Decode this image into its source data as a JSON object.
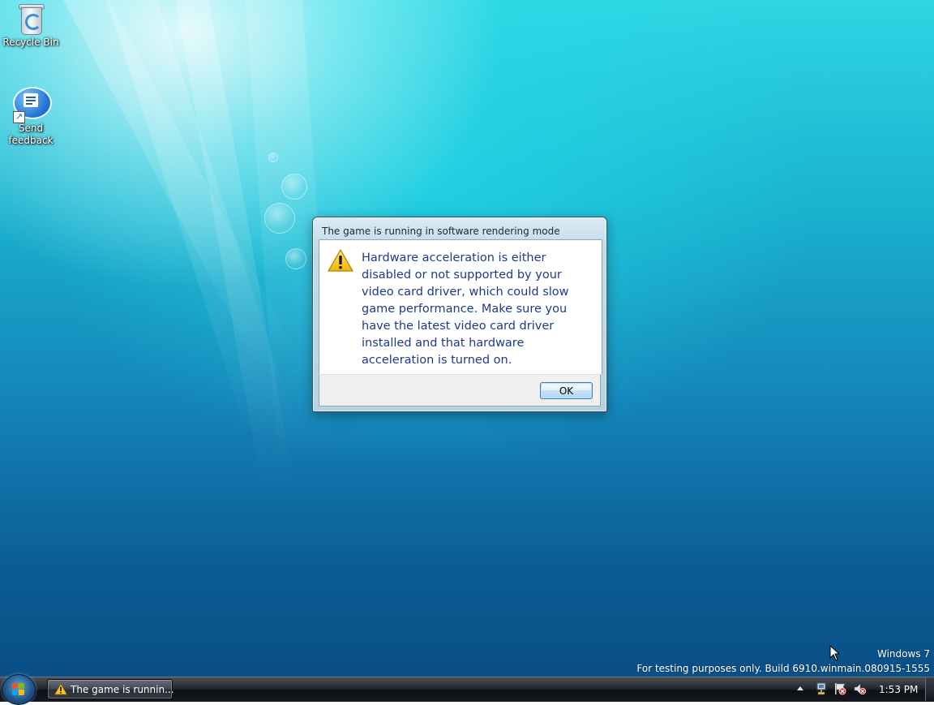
{
  "desktop": {
    "icons": [
      {
        "label": "Recycle Bin",
        "icon": "recycle-bin-icon"
      },
      {
        "label_line1": "Send",
        "label_line2": "feedback",
        "icon": "send-feedback-icon"
      }
    ],
    "watermark": {
      "line1": "Windows 7",
      "line2": "For testing purposes only. Build 6910.winmain.080915-1555"
    }
  },
  "dialog": {
    "title": "The game is running in software rendering mode",
    "icon": "warning-icon",
    "message": "Hardware acceleration is either disabled or not supported by your video card driver, which could slow game performance. Make sure you have the latest video card driver installed and that hardware acceleration is turned on.",
    "ok_label": "OK"
  },
  "taskbar": {
    "start_icon": "windows-start-orb",
    "task_label": "The game is runnin...",
    "tray_icons": [
      "network-icon",
      "action-center-flag-icon",
      "volume-muted-icon"
    ],
    "clock": "1:53 PM"
  },
  "colors": {
    "dialog_text": "#1e3a8c",
    "desktop_top": "#2fd6e3",
    "desktop_bottom": "#0a4f86"
  }
}
